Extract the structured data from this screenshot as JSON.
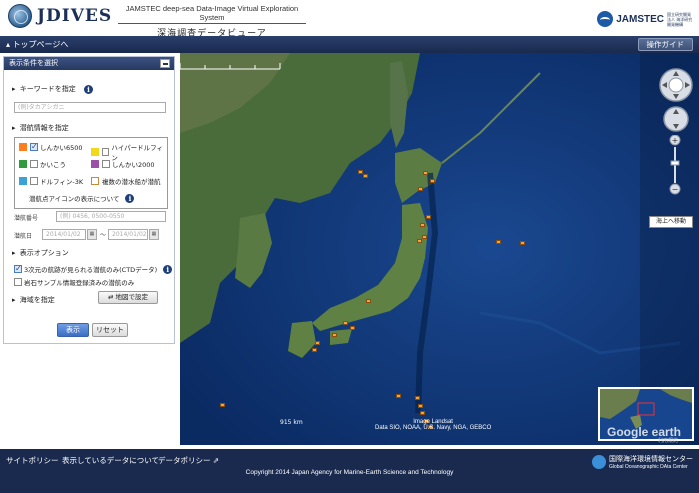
{
  "header": {
    "logo_text": "JDIVES",
    "subtitle_en": "JAMSTEC deep-sea Data-Image Virtual Exploration System",
    "subtitle_jp": "深海調査データビューア",
    "org_name": "JAMSTEC",
    "org_sub": "国立研究開発法人 海洋研究開発機構"
  },
  "navbar": {
    "top_link": "トップページへ",
    "guide_button": "操作ガイド"
  },
  "panel": {
    "title": "表示条件を選択",
    "keyword": {
      "label": "キーワードを指定",
      "placeholder": "(例)タカアシガニ"
    },
    "vessel": {
      "label": "潜航情報を指定",
      "items": [
        {
          "label": "しんかい6500",
          "checked": true,
          "color": "#ff7f1e"
        },
        {
          "label": "ハイパードルフィン",
          "checked": false,
          "color": "#f2d81a"
        },
        {
          "label": "かいこう",
          "checked": false,
          "color": "#2e9c3a"
        },
        {
          "label": "しんかい2000",
          "checked": false,
          "color": "#9b4fa6"
        },
        {
          "label": "ドルフィン-3K",
          "checked": false,
          "color": "#3aa2d6"
        },
        {
          "label": "複数の潜水船が潜航",
          "checked": false,
          "color": "#ffffff"
        }
      ],
      "icon_note": "潜航点アイコンの表示について"
    },
    "dive_number": {
      "label": "潜航番号",
      "placeholder": "(例) 0456, 0500-0550"
    },
    "dive_date": {
      "label": "潜航日",
      "from": "2014/01/02",
      "to": "2014/01/02",
      "sep": "〜",
      "cal_icon": "calendar-icon"
    },
    "options": {
      "label": "表示オプション",
      "items": [
        {
          "label": "3次元の航跡が見られる潜航のみ(CTDデータ)",
          "checked": true
        },
        {
          "label": "岩石サンプル情報登録済みの潜航のみ",
          "checked": false
        }
      ]
    },
    "area": {
      "label": "海域を指定",
      "map_button": "地図で設定"
    },
    "show_button": "表示",
    "reset_button": "リセット"
  },
  "map": {
    "move_sea_button": "海上へ移動",
    "scale_label": "915 km",
    "attribution_line1": "Image Landsat",
    "attribution_line2": "Data SIO, NOAA, U.S. Navy, NGA, GEBCO",
    "google_label": "Google earth",
    "earth_sub": "利用規約",
    "marker_color": "#f2a53a",
    "land_color": "#4a6b3a",
    "ocean_color": "#0d2f6e"
  },
  "footer": {
    "links": [
      "サイトポリシー",
      "表示しているデータについて",
      "データポリシー"
    ],
    "copyright": "Copyright 2014 Japan Agency for Marine-Earth Science and Technology",
    "godac_jp": "国際海洋環境情報センター",
    "godac_en": "Global Oceanographic DAta Center"
  }
}
